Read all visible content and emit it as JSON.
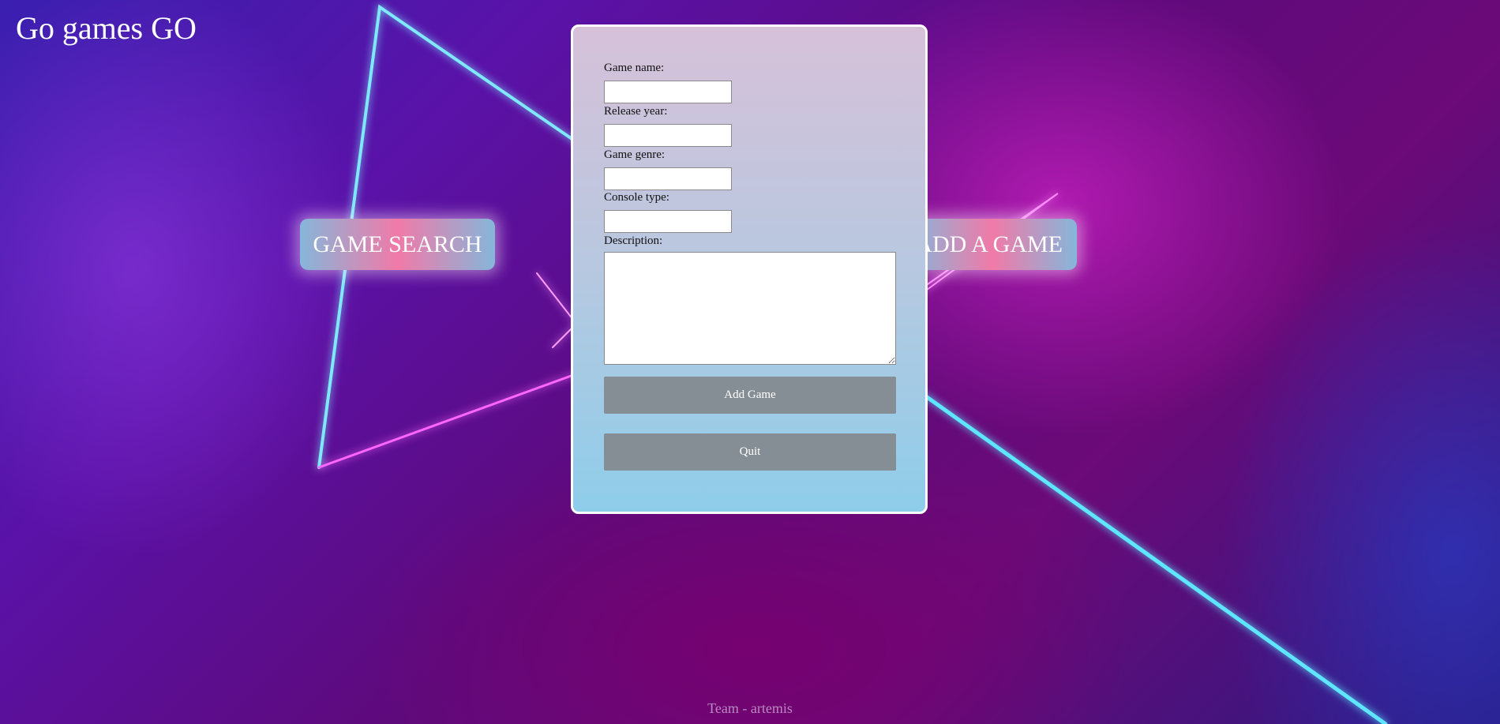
{
  "site_title": "Go games GO",
  "nav": {
    "search_label": "GAME SEARCH",
    "add_label": "ADD A GAME"
  },
  "form": {
    "game_name_label": "Game name:",
    "game_name_value": "",
    "release_year_label": "Release year:",
    "release_year_value": "",
    "game_genre_label": "Game genre:",
    "game_genre_value": "",
    "console_type_label": "Console type:",
    "console_type_value": "",
    "description_label": "Description:",
    "description_value": "",
    "add_button_label": "Add Game",
    "quit_button_label": "Quit"
  },
  "footer_text": "Team - artemis",
  "colors": {
    "panel_border": "#ffffff",
    "button_gray": "#858e94",
    "neon_cyan": "#3fe0ff",
    "neon_magenta": "#ff40ff"
  }
}
